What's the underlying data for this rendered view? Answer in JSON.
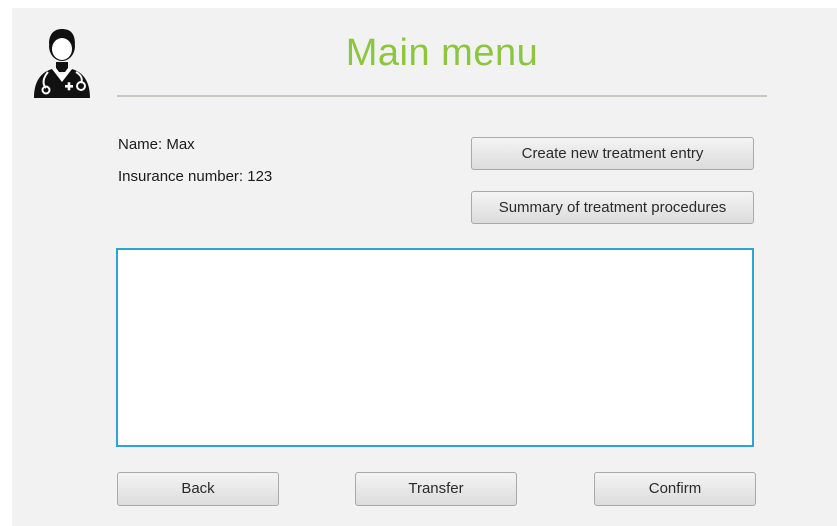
{
  "header": {
    "title": "Main menu",
    "avatar_icon": "doctor-avatar-icon"
  },
  "patient": {
    "name_label": "Name: Max",
    "insurance_label": "Insurance number: 123"
  },
  "actions": {
    "create_entry_label": "Create new treatment entry",
    "summary_label": "Summary of treatment procedures"
  },
  "notes": {
    "value": "",
    "placeholder": ""
  },
  "footer": {
    "back_label": "Back",
    "transfer_label": "Transfer",
    "confirm_label": "Confirm"
  },
  "colors": {
    "title": "#8cc63f",
    "window_background": "#f2f2f2",
    "textarea_border": "#2ea3d6"
  }
}
